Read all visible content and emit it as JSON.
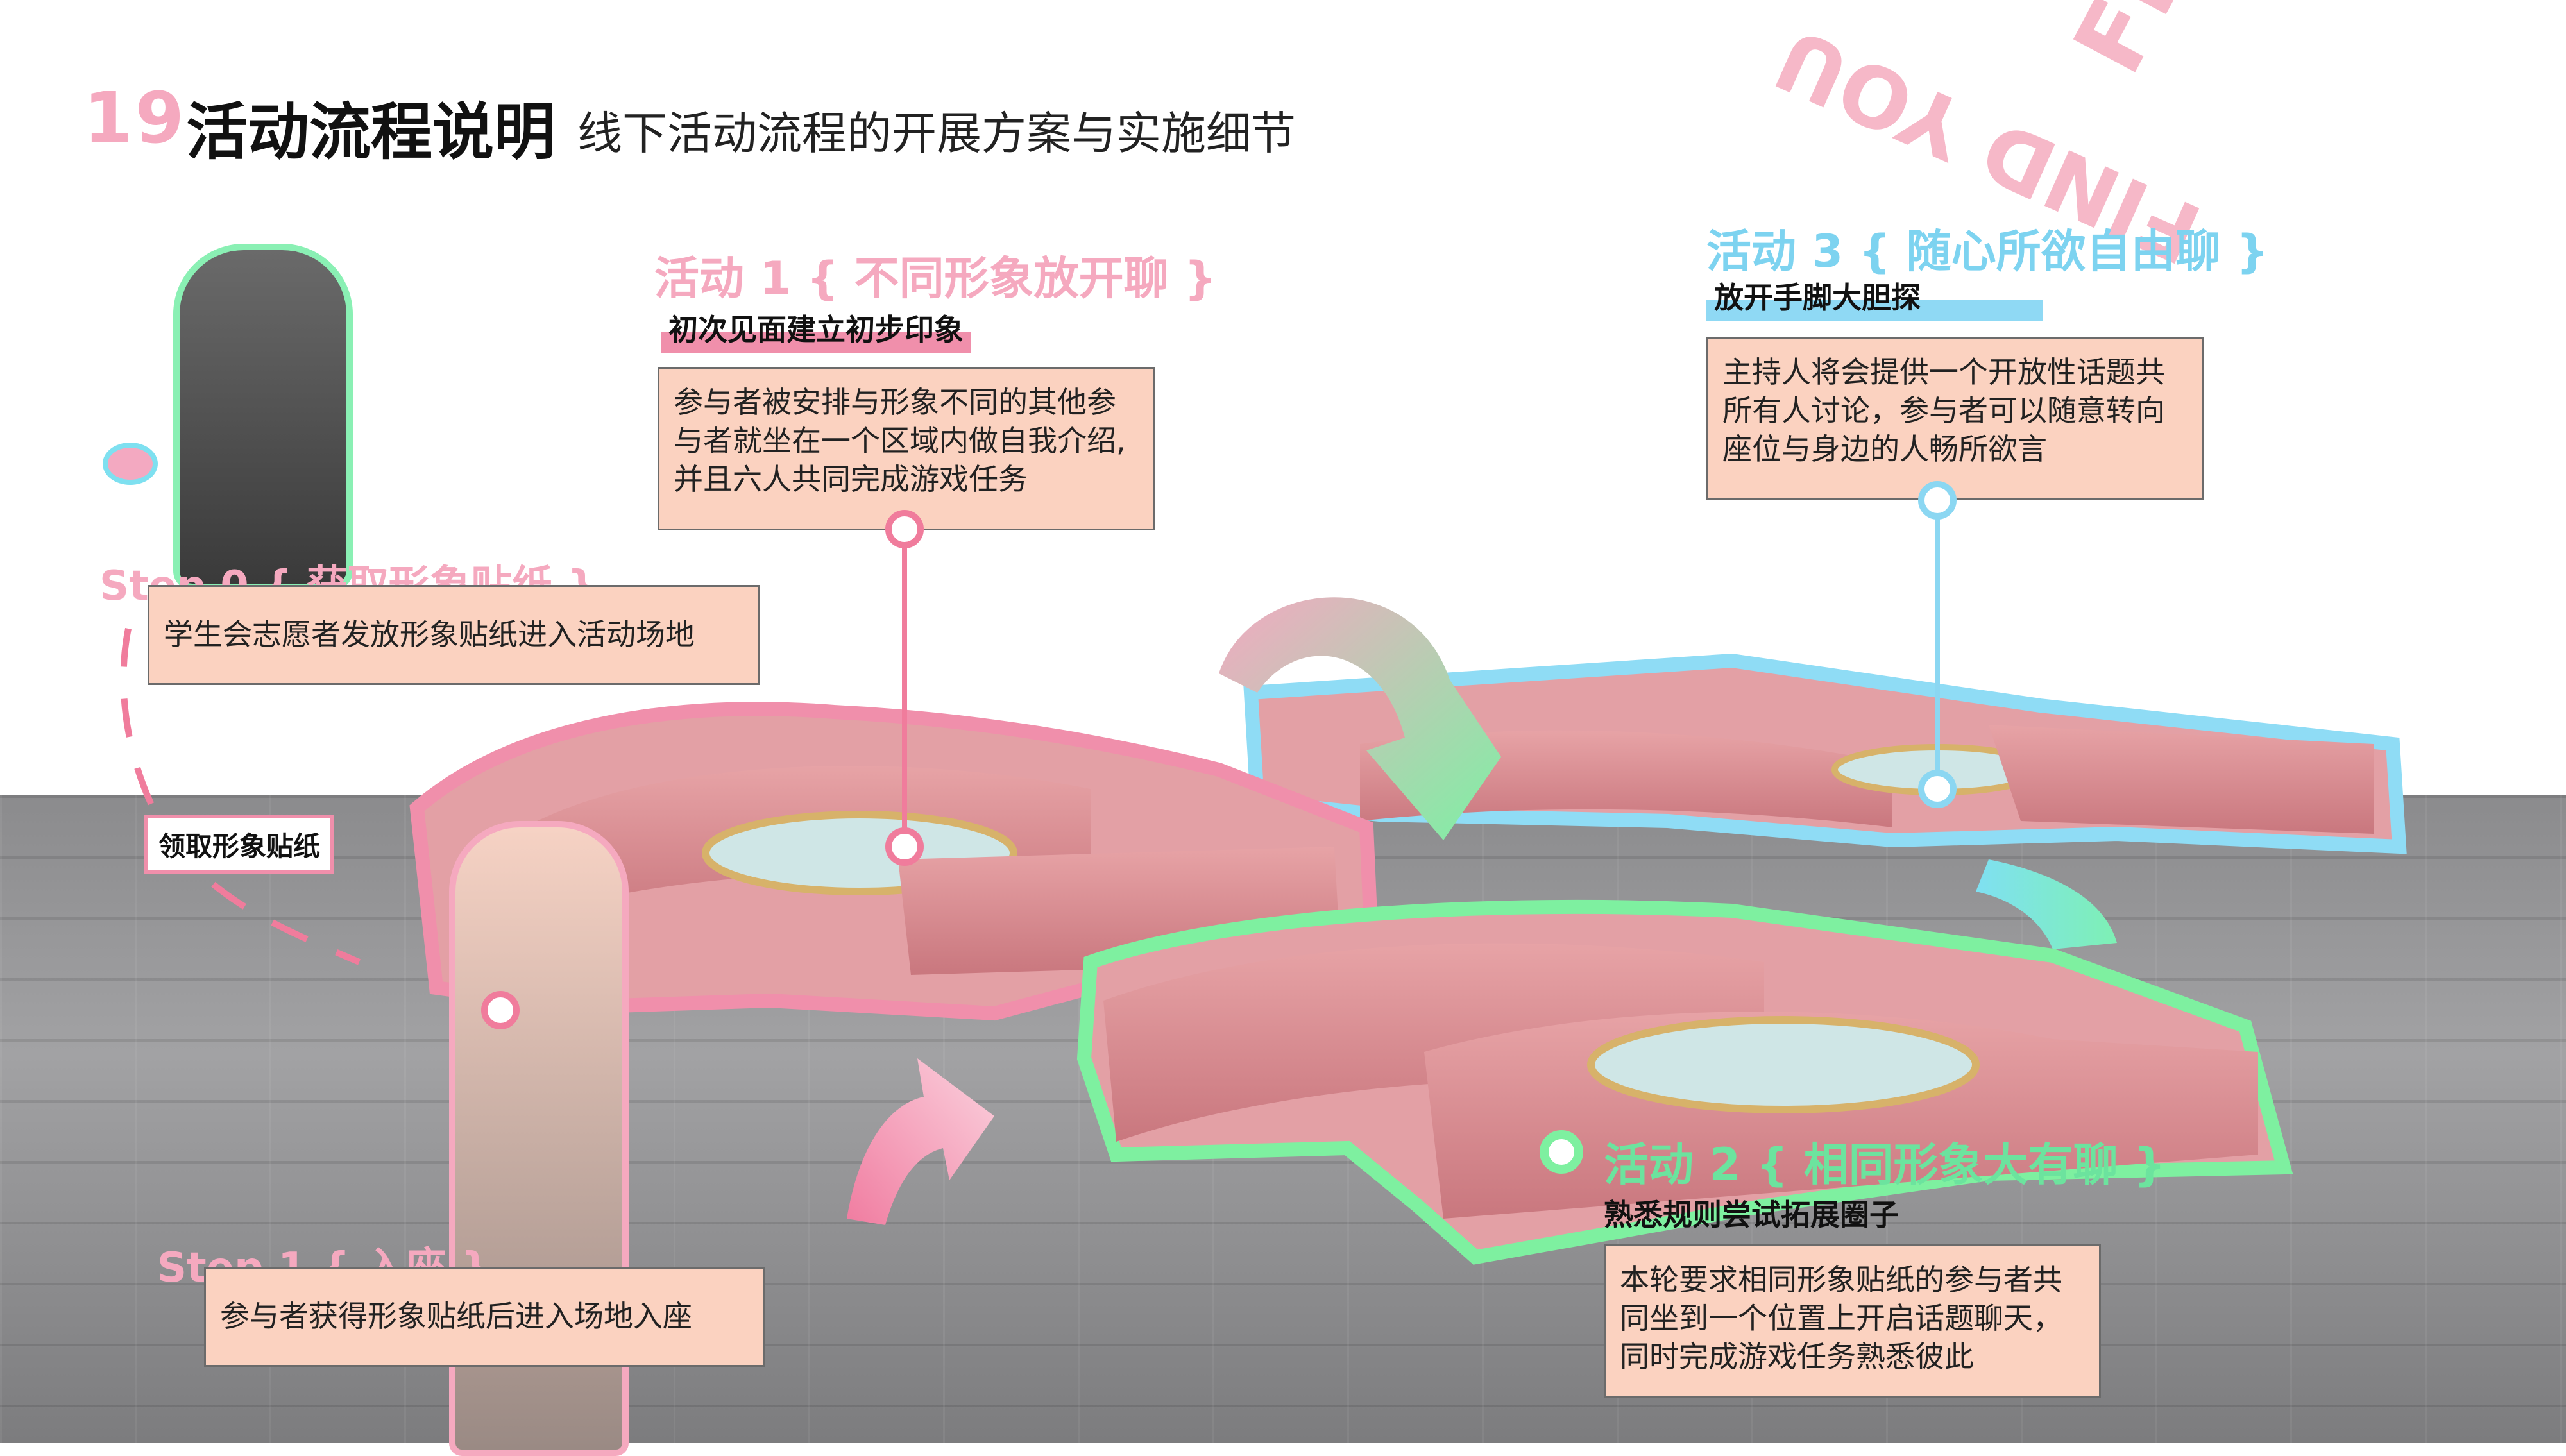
{
  "header": {
    "number": "19",
    "title": "活动流程说明",
    "subtitle": "线下活动流程的开展方案与实施细节"
  },
  "activity1": {
    "title": "活动 1 { 不同形象放开聊 }",
    "subtitle": "初次见面建立初步印象",
    "description": "参与者被安排与形象不同的其他参与者就坐在一个区域内做自我介绍,并且六人共同完成游戏任务"
  },
  "activity2": {
    "title": "活动 2 { 相同形象大有聊 }",
    "subtitle": "熟悉规则尝试拓展圈子",
    "description": "本轮要求相同形象贴纸的参与者共同坐到一个位置上开启话题聊天，同时完成游戏任务熟悉彼此"
  },
  "activity3": {
    "title": "活动 3 { 随心所欲自由聊 }",
    "subtitle": "放开手脚大胆探",
    "description": "主持人将会提供一个开放性话题共所有人讨论，参与者可以随意转向座位与身边的人畅所欲言"
  },
  "step0": {
    "title": "Step 0 { 获取形象贴纸 }",
    "description": "学生会志愿者发放形象贴纸进入活动场地",
    "tag": "领取形象贴纸"
  },
  "step1": {
    "title": "Step 1 { 入座 }",
    "description": "参与者获得形象贴纸后进入场地入座"
  },
  "watermark": {
    "text1": "FIND",
    "text2": "FIND YOU"
  },
  "colors": {
    "pink": "#f5a9bf",
    "blue": "#7dd3f0",
    "green": "#6ce39e",
    "box": "#fbd2c0"
  }
}
